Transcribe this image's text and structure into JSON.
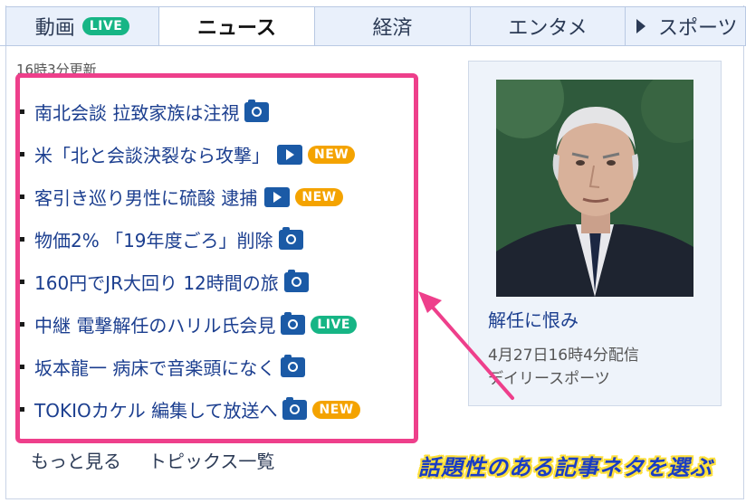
{
  "tabs": [
    {
      "label": "動画",
      "badge": "LIVE"
    },
    {
      "label": "ニュース"
    },
    {
      "label": "経済"
    },
    {
      "label": "エンタメ"
    },
    {
      "label": "スポーツ"
    }
  ],
  "updated": "16時3分更新",
  "news": [
    {
      "title": "南北会談 拉致家族は注視",
      "icon": "camera-icon"
    },
    {
      "title": "米「北と会談決裂なら攻撃」",
      "icon": "video-play-icon",
      "badge": "NEW"
    },
    {
      "title": "客引き巡り男性に硫酸 逮捕",
      "icon": "video-play-icon",
      "badge": "NEW"
    },
    {
      "title": "物価2% 「19年度ごろ」削除",
      "icon": "camera-icon"
    },
    {
      "title": "160円でJR大回り 12時間の旅",
      "icon": "camera-icon"
    },
    {
      "title": "中継 電撃解任のハリル氏会見",
      "icon": "camera-icon",
      "badge": "LIVE"
    },
    {
      "title": "坂本龍一 病床で音楽頭になく",
      "icon": "camera-icon"
    },
    {
      "title": "TOKIOカケル 編集して放送へ",
      "icon": "camera-icon",
      "badge": "NEW"
    }
  ],
  "more": {
    "more_label": "もっと見る",
    "topics_label": "トピックス一覧"
  },
  "side": {
    "headline": "解任に恨み",
    "date": "4月27日16時4分配信",
    "source": "デイリースポーツ"
  },
  "annotation": {
    "caption": "話題性のある記事ネタを選ぶ"
  },
  "colors": {
    "highlight": "#ee3f8b",
    "link": "#1b3e8f",
    "new_badge": "#f4a300",
    "live_badge": "#16b585",
    "icon": "#1b5aa6",
    "caption": "#1a3dc4",
    "caption_outline": "#ffe03a"
  }
}
